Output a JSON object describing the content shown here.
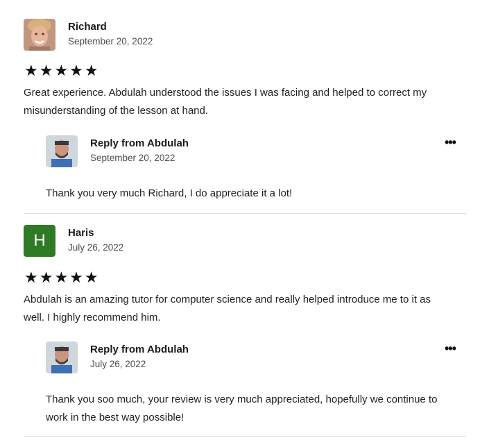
{
  "reviews": [
    {
      "name": "Richard",
      "date": "September 20, 2022",
      "rating": 5,
      "stars": "★★★★★",
      "text_lines": [
        "Great experience. Abdulah understood the issues I was facing and helped to correct my",
        "misunderstanding of the lesson at hand."
      ],
      "reply": {
        "title": "Reply from Abdulah",
        "date": "September 20, 2022",
        "text_lines": [
          "Thank you very much Richard, I do appreciate it a lot!"
        ],
        "menu_label": "•••"
      }
    },
    {
      "name": "Haris",
      "avatar_letter": "H",
      "avatar_color": "#2f7a24",
      "date": "July 26, 2022",
      "rating": 5,
      "stars": "★★★★★",
      "text_lines": [
        "Abdulah is an amazing tutor for computer science and really helped introduce me to it as",
        "well. I highly recommend him."
      ],
      "reply": {
        "title": "Reply from Abdulah",
        "date": "July 26, 2022",
        "text_lines": [
          "Thank you soo much, your review is very much appreciated, hopefully we continue to",
          "work in the best way possible!"
        ],
        "menu_label": "•••"
      }
    }
  ]
}
